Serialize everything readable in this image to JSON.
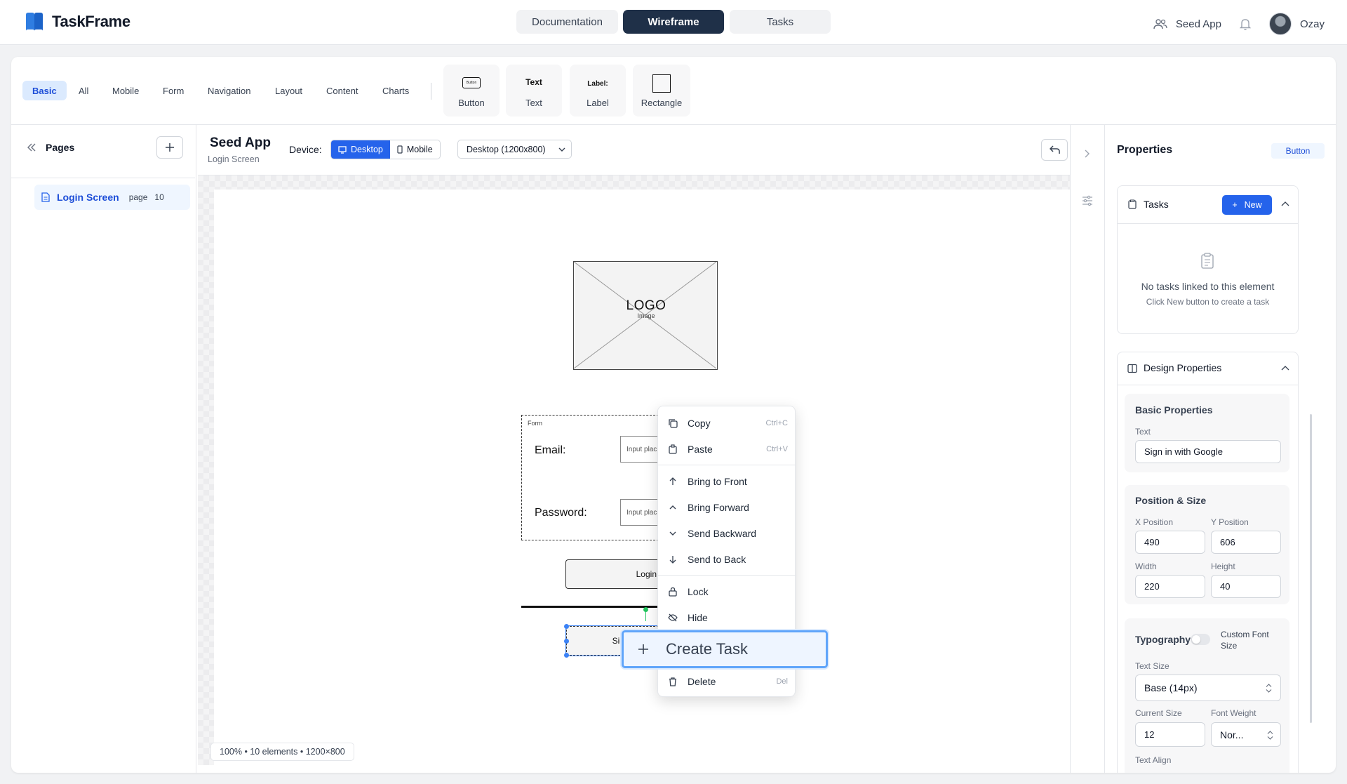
{
  "app": {
    "name": "TaskFrame"
  },
  "nav": {
    "tabs": [
      "Documentation",
      "Wireframe",
      "Tasks"
    ],
    "active": "Wireframe"
  },
  "topright": {
    "project": "Seed App",
    "user": "Ozay"
  },
  "palette": {
    "categories": [
      "Basic",
      "All",
      "Mobile",
      "Form",
      "Navigation",
      "Layout",
      "Content",
      "Charts"
    ],
    "active_category": "Basic",
    "items": [
      {
        "label": "Button",
        "preview": "Button"
      },
      {
        "label": "Text",
        "preview": "Text"
      },
      {
        "label": "Label",
        "preview": "Label:"
      },
      {
        "label": "Rectangle",
        "preview": ""
      }
    ]
  },
  "pages": {
    "title": "Pages",
    "items": [
      {
        "name": "Login Screen",
        "type": "page",
        "count": "10"
      }
    ]
  },
  "canvas": {
    "title": "Seed App",
    "subtitle": "Login Screen",
    "device_label": "Device:",
    "device_options": [
      "Desktop",
      "Mobile"
    ],
    "device_active": "Desktop",
    "resolution": "Desktop (1200x800)",
    "status": "100% • 10 elements • 1200×800"
  },
  "wireframe": {
    "logo_text": "LOGO",
    "logo_sub": "Image",
    "form_label": "Form",
    "email_label": "Email:",
    "password_label": "Password:",
    "input_placeholder": "Input plac",
    "login_button": "Login",
    "google_button": "Sig"
  },
  "context_menu": {
    "items": [
      {
        "label": "Copy",
        "shortcut": "Ctrl+C",
        "icon": "copy-icon"
      },
      {
        "label": "Paste",
        "shortcut": "Ctrl+V",
        "icon": "paste-icon"
      },
      {
        "label": "Bring to Front",
        "shortcut": "",
        "icon": "arrow-up-icon"
      },
      {
        "label": "Bring Forward",
        "shortcut": "",
        "icon": "chevron-up-icon"
      },
      {
        "label": "Send Backward",
        "shortcut": "",
        "icon": "chevron-down-icon"
      },
      {
        "label": "Send to Back",
        "shortcut": "",
        "icon": "arrow-down-icon"
      },
      {
        "label": "Lock",
        "shortcut": "",
        "icon": "lock-icon"
      },
      {
        "label": "Hide",
        "shortcut": "",
        "icon": "eye-off-icon"
      },
      {
        "label": "Delete",
        "shortcut": "Del",
        "icon": "trash-icon"
      }
    ],
    "highlight": "Create Task"
  },
  "properties": {
    "title": "Properties",
    "badge": "Button",
    "tasks": {
      "title": "Tasks",
      "new_button": "New",
      "empty_title": "No tasks linked to this element",
      "empty_hint": "Click New button to create a task"
    },
    "design": {
      "title": "Design Properties",
      "basic": {
        "title": "Basic Properties",
        "text_label": "Text",
        "text_value": "Sign in with Google"
      },
      "position": {
        "title": "Position & Size",
        "x_label": "X Position",
        "x_value": "490",
        "y_label": "Y Position",
        "y_value": "606",
        "w_label": "Width",
        "w_value": "220",
        "h_label": "Height",
        "h_value": "40"
      },
      "typography": {
        "title": "Typography",
        "toggle_label": "Custom Font Size",
        "toggle_on": false,
        "size_label": "Text Size",
        "size_value": "Base (14px)",
        "current_label": "Current Size",
        "current_value": "12",
        "weight_label": "Font Weight",
        "weight_value": "Nor...",
        "align_label": "Text Align"
      }
    }
  },
  "colors": {
    "accent": "#2563eb",
    "nav_active": "#1f3048",
    "highlight_border": "#3b82f6"
  }
}
